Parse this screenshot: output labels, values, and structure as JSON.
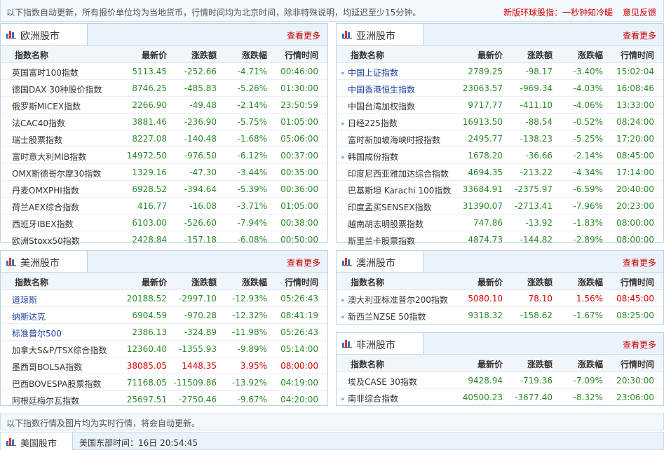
{
  "top": {
    "note": "以下指数自动更新，所有报价单位均为当地货币，行情时间均为北京时间，除非特殊说明，均延迟至少15分钟。",
    "link1": "新版环球股指：一秒钟知冷暖",
    "link2": "意见反馈"
  },
  "headers": {
    "name": "指数名称",
    "price": "最新价",
    "chg": "涨跌额",
    "pct": "涨跌幅",
    "time": "行情时间"
  },
  "more": "查看更多",
  "panels": {
    "europe": {
      "title": "欧洲股市",
      "rows": [
        {
          "name": "英国富时100指数",
          "price": "5113.45",
          "chg": "-252.66",
          "pct": "-4.71%",
          "time": "00:46:00",
          "dir": "down",
          "link": false,
          "arrow": false
        },
        {
          "name": "德国DAX 30种股价指数",
          "price": "8746.25",
          "chg": "-485.83",
          "pct": "-5.26%",
          "time": "01:30:00",
          "dir": "down",
          "link": false,
          "arrow": false
        },
        {
          "name": "俄罗斯MICEX指数",
          "price": "2266.90",
          "chg": "-49.48",
          "pct": "-2.14%",
          "time": "23:50:59",
          "dir": "down",
          "link": false,
          "arrow": false
        },
        {
          "name": "法CAC40指数",
          "price": "3881.46",
          "chg": "-236.90",
          "pct": "-5.75%",
          "time": "01:05:00",
          "dir": "down",
          "link": false,
          "arrow": false
        },
        {
          "name": "瑞士股票指数",
          "price": "8227.08",
          "chg": "-140.48",
          "pct": "-1.68%",
          "time": "05:06:00",
          "dir": "down",
          "link": false,
          "arrow": false
        },
        {
          "name": "富时意大利MIB指数",
          "price": "14972.50",
          "chg": "-976.50",
          "pct": "-6.12%",
          "time": "00:37:00",
          "dir": "down",
          "link": false,
          "arrow": false
        },
        {
          "name": "OMX斯德哥尔摩30指数",
          "price": "1329.16",
          "chg": "-47.30",
          "pct": "-3.44%",
          "time": "00:35:00",
          "dir": "down",
          "link": false,
          "arrow": false
        },
        {
          "name": "丹麦OMXPHI指数",
          "price": "6928.52",
          "chg": "-394.64",
          "pct": "-5.39%",
          "time": "00:36:00",
          "dir": "down",
          "link": false,
          "arrow": false
        },
        {
          "name": "荷兰AEX综合指数",
          "price": "416.77",
          "chg": "-16.08",
          "pct": "-3.71%",
          "time": "01:05:00",
          "dir": "down",
          "link": false,
          "arrow": false
        },
        {
          "name": "西班牙IBEX指数",
          "price": "6103.00",
          "chg": "-526.60",
          "pct": "-7.94%",
          "time": "00:38:00",
          "dir": "down",
          "link": false,
          "arrow": false
        },
        {
          "name": "欧洲Stoxx50指数",
          "price": "2428.84",
          "chg": "-157.18",
          "pct": "-6.08%",
          "time": "00:50:00",
          "dir": "down",
          "link": false,
          "arrow": false
        }
      ]
    },
    "asia": {
      "title": "亚洲股市",
      "rows": [
        {
          "name": "中国上证指数",
          "price": "2789.25",
          "chg": "-98.17",
          "pct": "-3.40%",
          "time": "15:02:04",
          "dir": "down",
          "link": true,
          "arrow": true
        },
        {
          "name": "中国香港恒生指数",
          "price": "23063.57",
          "chg": "-969.34",
          "pct": "-4.03%",
          "time": "16:08:46",
          "dir": "down",
          "link": true,
          "arrow": false
        },
        {
          "name": "中国台湾加权指数",
          "price": "9717.77",
          "chg": "-411.10",
          "pct": "-4.06%",
          "time": "13:33:00",
          "dir": "down",
          "link": false,
          "arrow": false
        },
        {
          "name": "日经225指数",
          "price": "16913.50",
          "chg": "-88.54",
          "pct": "-0.52%",
          "time": "08:24:00",
          "dir": "down",
          "link": false,
          "arrow": true
        },
        {
          "name": "富时新加坡海峡时报指数",
          "price": "2495.77",
          "chg": "-138.23",
          "pct": "-5.25%",
          "time": "17:20:00",
          "dir": "down",
          "link": false,
          "arrow": false
        },
        {
          "name": "韩国成份指数",
          "price": "1678.20",
          "chg": "-36.66",
          "pct": "-2.14%",
          "time": "08:45:00",
          "dir": "down",
          "link": false,
          "arrow": true
        },
        {
          "name": "印度尼西亚雅加达综合指数",
          "price": "4694.35",
          "chg": "-213.22",
          "pct": "-4.34%",
          "time": "17:14:00",
          "dir": "down",
          "link": false,
          "arrow": false
        },
        {
          "name": "巴基斯坦 Karachi 100指数",
          "price": "33684.91",
          "chg": "-2375.97",
          "pct": "-6.59%",
          "time": "20:40:00",
          "dir": "down",
          "link": false,
          "arrow": false
        },
        {
          "name": "印度孟买SENSEX指数",
          "price": "31390.07",
          "chg": "-2713.41",
          "pct": "-7.96%",
          "time": "20:23:00",
          "dir": "down",
          "link": false,
          "arrow": false
        },
        {
          "name": "越南胡志明股票指数",
          "price": "747.86",
          "chg": "-13.92",
          "pct": "-1.83%",
          "time": "08:00:00",
          "dir": "down",
          "link": false,
          "arrow": false
        },
        {
          "name": "斯里兰卡股票指数",
          "price": "4874.73",
          "chg": "-144.82",
          "pct": "-2.89%",
          "time": "08:00:00",
          "dir": "down",
          "link": false,
          "arrow": false
        }
      ]
    },
    "america": {
      "title": "美洲股市",
      "rows": [
        {
          "name": "道琼斯",
          "price": "20188.52",
          "chg": "-2997.10",
          "pct": "-12.93%",
          "time": "05:26:43",
          "dir": "down",
          "link": true,
          "arrow": false
        },
        {
          "name": "纳斯达克",
          "price": "6904.59",
          "chg": "-970.28",
          "pct": "-12.32%",
          "time": "08:41:19",
          "dir": "down",
          "link": true,
          "arrow": false
        },
        {
          "name": "标准普尔500",
          "price": "2386.13",
          "chg": "-324.89",
          "pct": "-11.98%",
          "time": "05:26:43",
          "dir": "down",
          "link": true,
          "arrow": false
        },
        {
          "name": "加拿大S&P/TSX综合指数",
          "price": "12360.40",
          "chg": "-1355.93",
          "pct": "-9.89%",
          "time": "05:14:00",
          "dir": "down",
          "link": false,
          "arrow": false
        },
        {
          "name": "墨西哥BOLSA指数",
          "price": "38085.05",
          "chg": "1448.35",
          "pct": "3.95%",
          "time": "08:00:00",
          "dir": "up",
          "link": false,
          "arrow": false
        },
        {
          "name": "巴西BOVESPA股票指数",
          "price": "71168.05",
          "chg": "-11509.86",
          "pct": "-13.92%",
          "time": "04:19:00",
          "dir": "down",
          "link": false,
          "arrow": false
        },
        {
          "name": "阿根廷梅尔瓦指数",
          "price": "25697.51",
          "chg": "-2750.46",
          "pct": "-9.67%",
          "time": "04:20:00",
          "dir": "down",
          "link": false,
          "arrow": false
        }
      ]
    },
    "oceania": {
      "title": "澳洲股市",
      "rows": [
        {
          "name": "澳大利亚标准普尔200指数",
          "price": "5080.10",
          "chg": "78.10",
          "pct": "1.56%",
          "time": "08:45:00",
          "dir": "up",
          "link": false,
          "arrow": true
        },
        {
          "name": "新西兰NZSE 50指数",
          "price": "9318.32",
          "chg": "-158.62",
          "pct": "-1.67%",
          "time": "08:25:00",
          "dir": "down",
          "link": false,
          "arrow": true
        }
      ]
    },
    "africa": {
      "title": "非洲股市",
      "rows": [
        {
          "name": "埃及CASE 30指数",
          "price": "9428.94",
          "chg": "-719.36",
          "pct": "-7.09%",
          "time": "20:30:00",
          "dir": "down",
          "link": false,
          "arrow": false
        },
        {
          "name": "南非综合指数",
          "price": "40500.23",
          "chg": "-3677.40",
          "pct": "-8.32%",
          "time": "23:06:00",
          "dir": "down",
          "link": false,
          "arrow": true
        }
      ]
    }
  },
  "bottom": {
    "note": "以下指数行情及图片均为实时行情，将会自动更新。",
    "us_tab": "美国股市",
    "us_time": "美国东部时间：16日 20:54:45"
  },
  "colors": {
    "up": "#dd0000",
    "down": "#2a8a2a",
    "link": "#1a3fa0",
    "accent": "#cc0000"
  }
}
